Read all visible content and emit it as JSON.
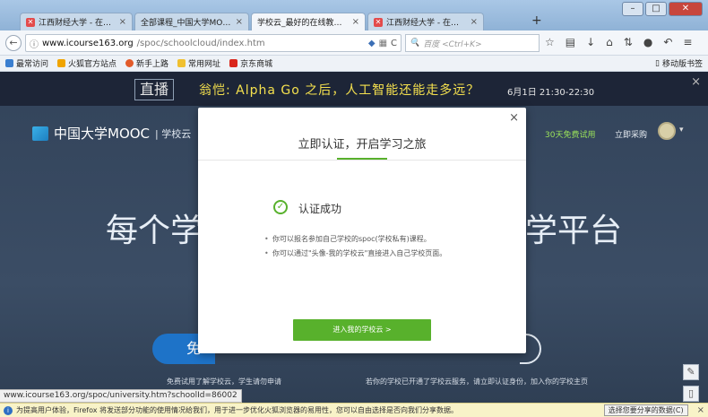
{
  "browser": {
    "tabs": [
      {
        "label": "江西财经大学 - 在线课程中心",
        "active": false,
        "favicon": "school-icon"
      },
      {
        "label": "全部课程_中国大学MOOC(慕课)",
        "active": false,
        "favicon": "mooc-icon"
      },
      {
        "label": "学校云_最好的在线教学平台_中国",
        "active": true,
        "favicon": "mooc-icon"
      },
      {
        "label": "江西财经大学 - 在线课程中心",
        "active": false,
        "favicon": "school-icon"
      }
    ],
    "new_tab": "+",
    "url_host": "www.icourse163.org",
    "url_path": "/spoc/schoolcloud/index.htm",
    "search_placeholder": "百度 <Ctrl+K>",
    "bookmarks": [
      {
        "label": "最常访问",
        "color": "#3b7fd0"
      },
      {
        "label": "火狐官方站点",
        "color": "#f0a400"
      },
      {
        "label": "新手上路",
        "color": "#e25b2a"
      },
      {
        "label": "常用网址",
        "color": "#f0c030"
      },
      {
        "label": "京东商城",
        "color": "#d9261c"
      }
    ],
    "mobile_bookmarks": "移动版书签",
    "status_url": "www.icourse163.org/spoc/university.htm?schoolId=86002",
    "notification": "为提高用户体验，Firefox 将发送部分功能的使用情况给我们，用于进一步优化火狐浏览器的易用性，您可以自由选择是否向我们分享数据。",
    "notification_button": "选择您要分享的数据(C)"
  },
  "banner": {
    "logo": "直播",
    "text": "翁恺: Alpha Go 之后，人工智能还能走多远？",
    "date": "6月1日 21:30-22:30"
  },
  "site": {
    "logo": "中国大学MOOC",
    "logo_sub": "学校云",
    "trial": "30天免费试用",
    "purchase": "立即采购",
    "hero_left": "每个学",
    "hero_right": "学平台",
    "hero_button": "免",
    "note_left": "免费试用了解学校云，学生请勿申请",
    "note_right": "若你的学校已开通了学校云服务，请立即认证身份，加入你的学校主页"
  },
  "modal": {
    "title": "立即认证，开启学习之旅",
    "success": "认证成功",
    "tips": [
      "你可以报名参加自己学校的spoc(学校私有)课程。",
      "你可以通过\"头像-我的学校云\"直接进入自己学校页面。"
    ],
    "enter_button": "进入我的学校云 >"
  }
}
